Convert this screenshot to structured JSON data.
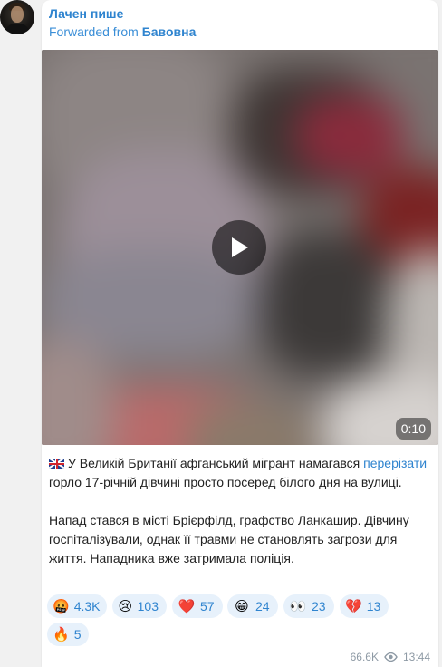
{
  "channel": {
    "author": "Лачен пише",
    "forwarded_prefix": "Forwarded from",
    "forwarded_source": "Бавовна"
  },
  "video": {
    "duration": "0:10",
    "play_icon": "play-icon"
  },
  "caption": {
    "flag_icon": "uk-flag-icon",
    "line1_start": "У Великій Британії афганський мігрант намагався ",
    "link_text": "перерізати",
    "line1_end": " горло 17-річній дівчині просто посеред білого дня на вулиці.",
    "paragraph2": "Напад стався в місті Брієрфілд, графство Ланкашир. Дівчину госпіталізували, однак її травми не становлять загрози для життя. Нападника вже затримала поліція."
  },
  "reactions": [
    {
      "emoji": "🤬",
      "icon": "angry-face-icon",
      "count": "4.3K"
    },
    {
      "emoji": "😢",
      "icon": "crying-face-icon",
      "count": "103"
    },
    {
      "emoji": "❤️",
      "icon": "heart-icon",
      "count": "57"
    },
    {
      "emoji": "😁",
      "icon": "grinning-face-icon",
      "count": "24"
    },
    {
      "emoji": "👀",
      "icon": "eyes-icon",
      "count": "23"
    },
    {
      "emoji": "💔",
      "icon": "broken-heart-icon",
      "count": "13"
    },
    {
      "emoji": "🔥",
      "icon": "fire-icon",
      "count": "5"
    }
  ],
  "meta": {
    "views": "66.6K",
    "views_icon": "eye-icon",
    "time": "13:44"
  },
  "colors": {
    "link": "#2f84cf",
    "reaction_bg": "#e7f1fb",
    "meta": "#8e9aa5"
  }
}
